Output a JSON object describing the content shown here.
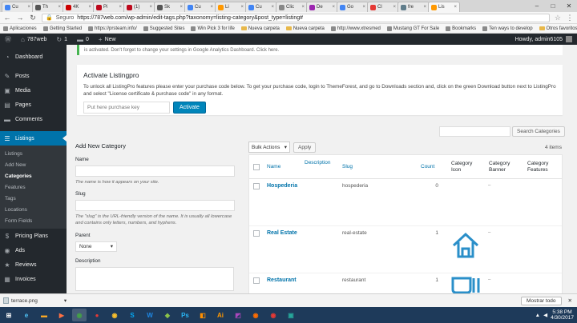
{
  "browser": {
    "tabs": [
      {
        "label": "Cu",
        "color": "#4285f4"
      },
      {
        "label": "Th",
        "color": "#555555"
      },
      {
        "label": "4K",
        "color": "#cc0000"
      },
      {
        "label": "Pi",
        "color": "#bd081c"
      },
      {
        "label": "(1)",
        "color": "#bd081c"
      },
      {
        "label": "Sk",
        "color": "#555555"
      },
      {
        "label": "Cu",
        "color": "#4285f4"
      },
      {
        "label": "Li",
        "color": "#ff9800"
      },
      {
        "label": "Cu",
        "color": "#4285f4"
      },
      {
        "label": "Clic",
        "color": "#888888"
      },
      {
        "label": "De",
        "color": "#9c27b0"
      },
      {
        "label": "Go",
        "color": "#4285f4"
      },
      {
        "label": "Cl",
        "color": "#e53935"
      },
      {
        "label": "fre",
        "color": "#607d8b"
      },
      {
        "label": "Lis",
        "color": "#ff9800"
      }
    ],
    "active_tab_index": 14,
    "secure_label": "Seguro",
    "url": "https://787web.com/wp-admin/edit-tags.php?taxonomy=listing-category&post_type=listing#",
    "bookmarks": [
      {
        "label": "Aplicaciones",
        "kind": "apps"
      },
      {
        "label": "Getting Started",
        "kind": "page"
      },
      {
        "label": "https://prsteam.info/",
        "kind": "page"
      },
      {
        "label": "Suggested Sites",
        "kind": "page"
      },
      {
        "label": "Win Pick 3 for life",
        "kind": "page"
      },
      {
        "label": "Nueva carpeta",
        "kind": "folder"
      },
      {
        "label": "Nueva carpeta",
        "kind": "folder"
      },
      {
        "label": "http://www.xtresmed",
        "kind": "page"
      },
      {
        "label": "Mustang GT For Sale",
        "kind": "page"
      },
      {
        "label": "Bookmarks",
        "kind": "page"
      },
      {
        "label": "Ten ways to develop",
        "kind": "page"
      }
    ],
    "other_bookmarks": "Otros favoritos"
  },
  "adminbar": {
    "site_name": "787web",
    "updates_count": "1",
    "comments_count": "0",
    "new_label": "New",
    "howdy": "Howdy, admin6105"
  },
  "sidebar": {
    "items_top": [
      {
        "label": "Dashboard",
        "icon": "dashboard-icon",
        "glyph": "◔"
      },
      {
        "label": "Posts",
        "icon": "pin-icon",
        "glyph": "✎"
      },
      {
        "label": "Media",
        "icon": "media-icon",
        "glyph": "▣"
      },
      {
        "label": "Pages",
        "icon": "pages-icon",
        "glyph": "▤"
      },
      {
        "label": "Comments",
        "icon": "comments-icon",
        "glyph": "▬"
      }
    ],
    "current": {
      "label": "Listings",
      "icon": "listings-icon",
      "glyph": "☰"
    },
    "submenu": [
      "Listings",
      "Add New",
      "Categories",
      "Features",
      "Tags",
      "Locations",
      "Form Fields"
    ],
    "submenu_current_index": 2,
    "items_bottom": [
      {
        "label": "Pricing Plans",
        "icon": "dollar-icon",
        "glyph": "$"
      },
      {
        "label": "Ads",
        "icon": "ads-icon",
        "glyph": "◉"
      },
      {
        "label": "Reviews",
        "icon": "star-icon",
        "glyph": "★"
      },
      {
        "label": "Invoices",
        "icon": "invoice-icon",
        "glyph": "▦"
      }
    ]
  },
  "main": {
    "top_notice": "is activated. Don't forget to change your settings in Google Analytics Dashboard. Click here.",
    "activate": {
      "title": "Activate Listingpro",
      "text": "To unlock all ListingPro features please enter your purchase code below. To get your purchase code, login to ThemeForest, and go to Downloads section and, click on the green Download button next to ListingPro and select \"License certificate & purchase code\" in any format.",
      "placeholder": "Put here purchase key",
      "button": "Activate"
    },
    "search_button": "Search Categories",
    "add_category": {
      "heading": "Add New Category",
      "name_label": "Name",
      "name_help": "The name is how it appears on your site.",
      "slug_label": "Slug",
      "slug_help": "The \"slug\" is the URL-friendly version of the name. It is usually all lowercase and contains only letters, numbers, and hyphens.",
      "parent_label": "Parent",
      "parent_value": "None",
      "description_label": "Description"
    },
    "bulk": {
      "select_value": "Bulk Actions",
      "apply": "Apply"
    },
    "items_count": "4 items",
    "columns": {
      "name": "Name",
      "description": "Description",
      "slug": "Slug",
      "count": "Count",
      "category_icon": "Category Icon",
      "category_banner": "Category Banner",
      "category_features": "Category Features"
    },
    "rows": [
      {
        "name": "Hospederia",
        "slug": "hospederia",
        "count": "0",
        "icon": "",
        "banner": "–"
      },
      {
        "name": "Real Estate",
        "slug": "real-estate",
        "count": "1",
        "icon": "house-icon",
        "banner": "–"
      },
      {
        "name": "Restaurant",
        "slug": "restaurant",
        "count": "1",
        "icon": "cup-icon",
        "banner": "–"
      }
    ]
  },
  "downloads": {
    "file": "terrace.png",
    "show_all": "Mostrar todo"
  },
  "taskbar": {
    "apps": [
      {
        "icon": "windows-start-icon",
        "glyph": "⊞",
        "color": "#ffffff"
      },
      {
        "icon": "ie-icon",
        "glyph": "e",
        "color": "#4fc3f7"
      },
      {
        "icon": "explorer-icon",
        "glyph": "▬",
        "color": "#f9a825"
      },
      {
        "icon": "media-player-icon",
        "glyph": "▶",
        "color": "#ff7043"
      },
      {
        "icon": "chrome-icon",
        "glyph": "◉",
        "color": "#43a047"
      },
      {
        "icon": "circle-app-icon",
        "glyph": "●",
        "color": "#e53935"
      },
      {
        "icon": "chrome-icon",
        "glyph": "◉",
        "color": "#fbc02d"
      },
      {
        "icon": "skype-icon",
        "glyph": "S",
        "color": "#03a9f4"
      },
      {
        "icon": "word-icon",
        "glyph": "W",
        "color": "#1e88e5"
      },
      {
        "icon": "app-icon",
        "glyph": "◆",
        "color": "#8bc34a"
      },
      {
        "icon": "photoshop-icon",
        "glyph": "Ps",
        "color": "#29b6f6"
      },
      {
        "icon": "image-app-icon",
        "glyph": "◧",
        "color": "#ff8f00"
      },
      {
        "icon": "illustrator-icon",
        "glyph": "Ai",
        "color": "#ff9800"
      },
      {
        "icon": "app-icon",
        "glyph": "◩",
        "color": "#ab47bc"
      },
      {
        "icon": "firefox-icon",
        "glyph": "◉",
        "color": "#ff6d00"
      },
      {
        "icon": "chrome-icon",
        "glyph": "◉",
        "color": "#e53935"
      },
      {
        "icon": "app-icon",
        "glyph": "▣",
        "color": "#26a69a"
      }
    ],
    "time": "5:38 PM",
    "date": "4/30/2017"
  }
}
